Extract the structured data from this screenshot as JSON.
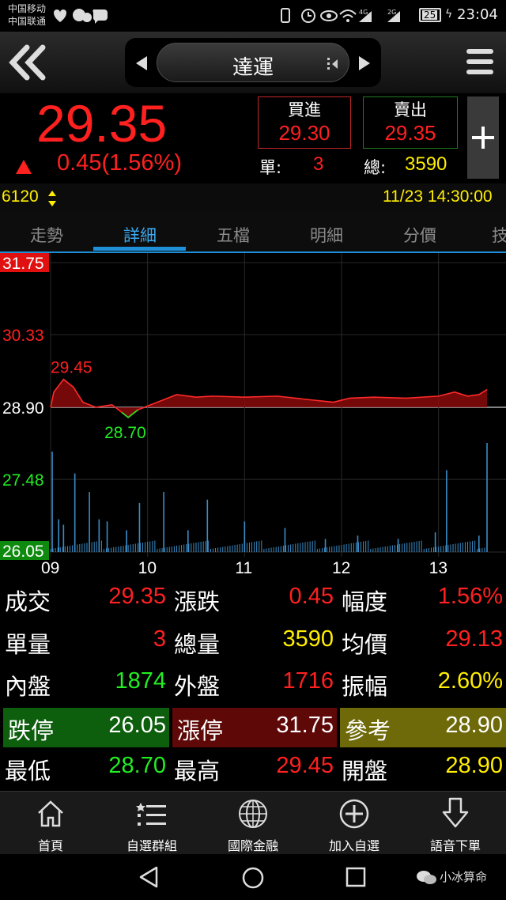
{
  "status_bar": {
    "carrier1": "中国移动",
    "carrier2": "中国联通",
    "battery": "25",
    "time": "23:04"
  },
  "header": {
    "stock_name": "達運",
    "back_icon": "double-chevron-left-icon",
    "menu_icon": "hamburger-icon"
  },
  "quote": {
    "last_price": "29.35",
    "change": "0.45(1.56%)",
    "bid_label": "買進",
    "bid_value": "29.30",
    "ask_label": "賣出",
    "ask_value": "29.35",
    "unit_label": "單:",
    "unit_value": "3",
    "total_label": "總:",
    "total_value": "3590",
    "add_icon": "plus-icon"
  },
  "info_bar": {
    "code": "6120",
    "datetime": "11/23 14:30:00"
  },
  "tabs": [
    {
      "label": "走勢",
      "active": false
    },
    {
      "label": "詳細",
      "active": true
    },
    {
      "label": "五檔",
      "active": false
    },
    {
      "label": "明細",
      "active": false
    },
    {
      "label": "分價",
      "active": false
    },
    {
      "label": "技",
      "active": false
    }
  ],
  "chart_data": {
    "type": "line",
    "ylim": [
      26.05,
      31.75
    ],
    "y_ticks": [
      "31.75",
      "30.33",
      "28.90",
      "27.48",
      "26.05"
    ],
    "reference": 28.9,
    "x_ticks": [
      "09",
      "10",
      "11",
      "12",
      "13"
    ],
    "high_label": "29.45",
    "low_label": "28.70",
    "price_series": [
      {
        "t": 0,
        "p": 28.9
      },
      {
        "t": 2,
        "p": 29.2
      },
      {
        "t": 8,
        "p": 29.45
      },
      {
        "t": 14,
        "p": 29.3
      },
      {
        "t": 20,
        "p": 29.0
      },
      {
        "t": 28,
        "p": 28.9
      },
      {
        "t": 38,
        "p": 28.95
      },
      {
        "t": 44,
        "p": 28.8
      },
      {
        "t": 48,
        "p": 28.7
      },
      {
        "t": 54,
        "p": 28.85
      },
      {
        "t": 62,
        "p": 28.95
      },
      {
        "t": 70,
        "p": 29.05
      },
      {
        "t": 78,
        "p": 29.15
      },
      {
        "t": 90,
        "p": 29.1
      },
      {
        "t": 100,
        "p": 29.12
      },
      {
        "t": 120,
        "p": 29.1
      },
      {
        "t": 140,
        "p": 29.12
      },
      {
        "t": 160,
        "p": 29.05
      },
      {
        "t": 175,
        "p": 29.0
      },
      {
        "t": 185,
        "p": 29.08
      },
      {
        "t": 200,
        "p": 29.1
      },
      {
        "t": 220,
        "p": 29.08
      },
      {
        "t": 240,
        "p": 29.12
      },
      {
        "t": 250,
        "p": 29.2
      },
      {
        "t": 258,
        "p": 29.12
      },
      {
        "t": 265,
        "p": 29.15
      },
      {
        "t": 270,
        "p": 29.25
      }
    ],
    "volume_series": [
      {
        "t": 1,
        "v": 0.92
      },
      {
        "t": 5,
        "v": 0.3
      },
      {
        "t": 8,
        "v": 0.25
      },
      {
        "t": 15,
        "v": 0.72
      },
      {
        "t": 24,
        "v": 0.55
      },
      {
        "t": 30,
        "v": 0.3
      },
      {
        "t": 35,
        "v": 0.28
      },
      {
        "t": 47,
        "v": 0.2
      },
      {
        "t": 55,
        "v": 0.45
      },
      {
        "t": 70,
        "v": 0.55
      },
      {
        "t": 85,
        "v": 0.2
      },
      {
        "t": 97,
        "v": 0.48
      },
      {
        "t": 120,
        "v": 0.28
      },
      {
        "t": 145,
        "v": 0.22
      },
      {
        "t": 170,
        "v": 0.12
      },
      {
        "t": 190,
        "v": 0.15
      },
      {
        "t": 215,
        "v": 0.12
      },
      {
        "t": 238,
        "v": 0.18
      },
      {
        "t": 245,
        "v": 0.75
      },
      {
        "t": 265,
        "v": 0.15
      },
      {
        "t": 270,
        "v": 1.0
      }
    ]
  },
  "table": [
    [
      {
        "label": "成交",
        "value": "29.35",
        "color": "#ff2020",
        "bg": ""
      },
      {
        "label": "漲跌",
        "value": "0.45",
        "color": "#ff2020",
        "bg": ""
      },
      {
        "label": "幅度",
        "value": "1.56%",
        "color": "#ff2020",
        "bg": ""
      }
    ],
    [
      {
        "label": "單量",
        "value": "3",
        "color": "#ff2020",
        "bg": ""
      },
      {
        "label": "總量",
        "value": "3590",
        "color": "#ffee00",
        "bg": ""
      },
      {
        "label": "均價",
        "value": "29.13",
        "color": "#ff2020",
        "bg": ""
      }
    ],
    [
      {
        "label": "內盤",
        "value": "1874",
        "color": "#22ee22",
        "bg": ""
      },
      {
        "label": "外盤",
        "value": "1716",
        "color": "#ff2020",
        "bg": ""
      },
      {
        "label": "振幅",
        "value": "2.60%",
        "color": "#ffee00",
        "bg": ""
      }
    ],
    [
      {
        "label": "跌停",
        "value": "26.05",
        "color": "#ffffff",
        "bg": "#0d5e0d"
      },
      {
        "label": "漲停",
        "value": "31.75",
        "color": "#ffffff",
        "bg": "#5e0808"
      },
      {
        "label": "參考",
        "value": "28.90",
        "color": "#ffffff",
        "bg": "#6e6a0a"
      }
    ],
    [
      {
        "label": "最低",
        "value": "28.70",
        "color": "#22ee22",
        "bg": ""
      },
      {
        "label": "最高",
        "value": "29.45",
        "color": "#ff2020",
        "bg": ""
      },
      {
        "label": "開盤",
        "value": "28.90",
        "color": "#ffee00",
        "bg": ""
      }
    ]
  ],
  "bottom_nav": [
    {
      "label": "首頁",
      "icon": "home-icon"
    },
    {
      "label": "自選群組",
      "icon": "list-icon"
    },
    {
      "label": "國際金融",
      "icon": "globe-icon"
    },
    {
      "label": "加入自選",
      "icon": "add-circle-icon"
    },
    {
      "label": "語音下單",
      "icon": "download-arrow-icon"
    }
  ],
  "watermark": "小冰算命"
}
